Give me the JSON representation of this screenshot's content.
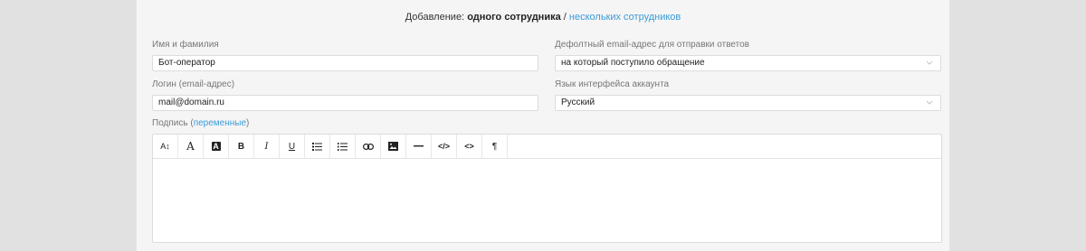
{
  "heading": {
    "prefix": "Добавление:",
    "current": "одного сотрудника",
    "separator": "/",
    "alternative": "нескольких сотрудников"
  },
  "fields": {
    "name": {
      "label": "Имя и фамилия",
      "value": "Бот-оператор"
    },
    "login": {
      "label": "Логин (email-адрес)",
      "value": "mail@domain.ru"
    },
    "default_email": {
      "label": "Дефолтный email-адрес для отправки ответов",
      "value": "на который поступило обращение"
    },
    "language": {
      "label": "Язык интерфейса аккаунта",
      "value": "Русский"
    },
    "signature": {
      "label_prefix": "Подпись (",
      "label_link": "переменные",
      "label_suffix": ")"
    }
  },
  "toolbar": {
    "items": [
      {
        "name": "font-size-icon",
        "glyph": "A↕"
      },
      {
        "name": "font-family-icon",
        "glyph": "A"
      },
      {
        "name": "text-highlight-icon",
        "glyph": "A"
      },
      {
        "name": "bold-icon",
        "glyph": "B"
      },
      {
        "name": "italic-icon",
        "glyph": "I"
      },
      {
        "name": "underline-icon",
        "glyph": "U"
      },
      {
        "name": "bulleted-list-icon",
        "glyph": ""
      },
      {
        "name": "numbered-list-icon",
        "glyph": ""
      },
      {
        "name": "link-icon",
        "glyph": ""
      },
      {
        "name": "image-icon",
        "glyph": ""
      },
      {
        "name": "horizontal-rule-icon",
        "glyph": ""
      },
      {
        "name": "code-view-icon",
        "glyph": "</>"
      },
      {
        "name": "code-inline-icon",
        "glyph": "<>"
      },
      {
        "name": "paragraph-icon",
        "glyph": "¶"
      }
    ]
  },
  "colors": {
    "accent": "#3b9bd8",
    "panel": "#f5f5f5",
    "background": "#e1e1e1"
  }
}
